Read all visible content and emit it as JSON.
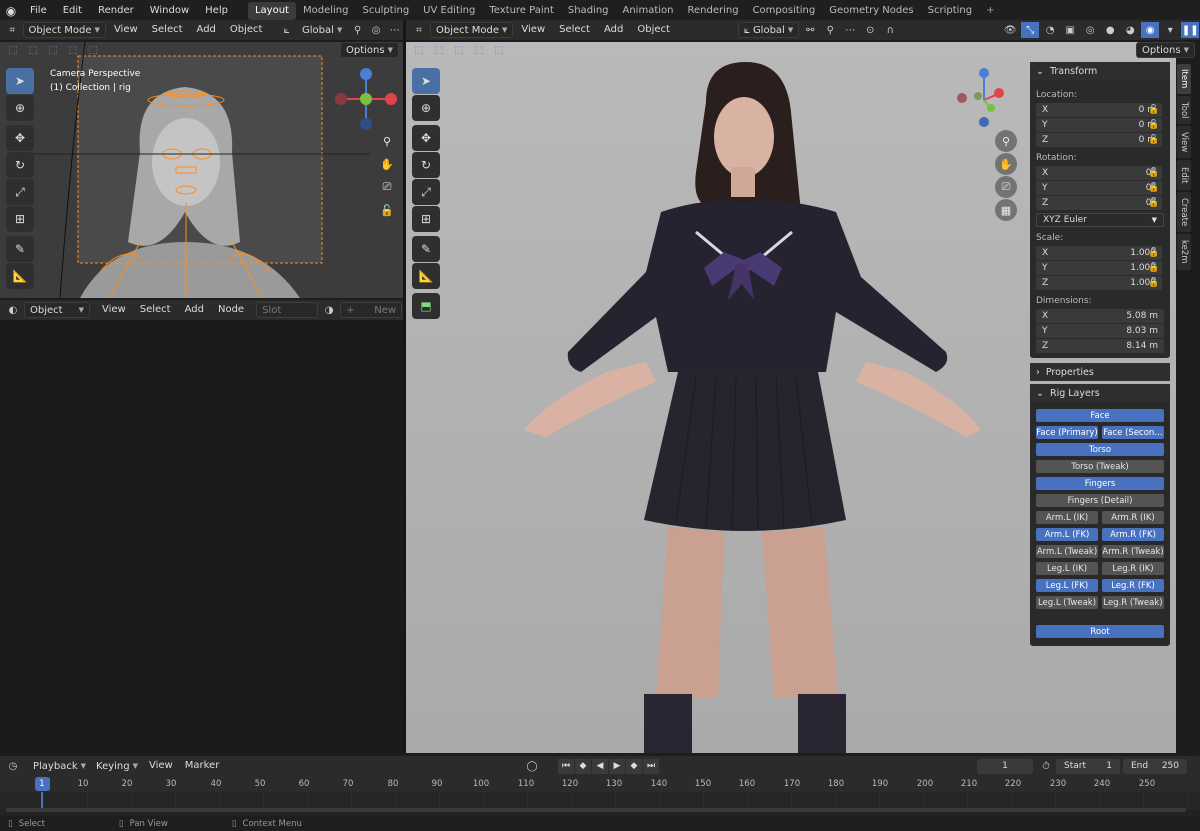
{
  "menu": {
    "items": [
      "File",
      "Edit",
      "Render",
      "Window",
      "Help"
    ]
  },
  "workspaces": {
    "items": [
      "Layout",
      "Modeling",
      "Sculpting",
      "UV Editing",
      "Texture Paint",
      "Shading",
      "Animation",
      "Rendering",
      "Compositing",
      "Geometry Nodes",
      "Scripting"
    ],
    "active": "Layout",
    "plus": "+"
  },
  "left_header": {
    "mode": "Object Mode",
    "menus": [
      "View",
      "Select",
      "Add",
      "Object"
    ],
    "orientation": "Global",
    "options": "Options"
  },
  "main_header": {
    "mode": "Object Mode",
    "menus": [
      "View",
      "Select",
      "Add",
      "Object"
    ],
    "orientation": "Global",
    "options": "Options"
  },
  "camera_overlay": {
    "line1": "Camera Perspective",
    "line2": "(1) Collection | rig"
  },
  "shader_header": {
    "type": "Object",
    "menus": [
      "View",
      "Select",
      "Add",
      "Node"
    ],
    "slot": "Slot",
    "new": "New"
  },
  "transform": {
    "title": "Transform",
    "location_label": "Location:",
    "location": [
      {
        "axis": "X",
        "value": "0 m"
      },
      {
        "axis": "Y",
        "value": "0 m"
      },
      {
        "axis": "Z",
        "value": "0 m"
      }
    ],
    "rotation_label": "Rotation:",
    "rotation": [
      {
        "axis": "X",
        "value": "0°"
      },
      {
        "axis": "Y",
        "value": "0°"
      },
      {
        "axis": "Z",
        "value": "0°"
      }
    ],
    "rotation_mode": "XYZ Euler",
    "scale_label": "Scale:",
    "scale": [
      {
        "axis": "X",
        "value": "1.000"
      },
      {
        "axis": "Y",
        "value": "1.000"
      },
      {
        "axis": "Z",
        "value": "1.000"
      }
    ],
    "dimensions_label": "Dimensions:",
    "dimensions": [
      {
        "axis": "X",
        "value": "5.08 m"
      },
      {
        "axis": "Y",
        "value": "8.03 m"
      },
      {
        "axis": "Z",
        "value": "8.14 m"
      }
    ]
  },
  "properties": {
    "title": "Properties"
  },
  "rig_layers": {
    "title": "Rig Layers",
    "face": "Face",
    "face_primary": "Face (Primary)",
    "face_secondary": "Face (Secon…",
    "torso": "Torso",
    "torso_tweak": "Torso (Tweak)",
    "fingers": "Fingers",
    "fingers_detail": "Fingers (Detail)",
    "arm_l_ik": "Arm.L (IK)",
    "arm_r_ik": "Arm.R (IK)",
    "arm_l_fk": "Arm.L (FK)",
    "arm_r_fk": "Arm.R (FK)",
    "arm_l_tweak": "Arm.L (Tweak)",
    "arm_r_tweak": "Arm.R (Tweak)",
    "leg_l_ik": "Leg.L (IK)",
    "leg_r_ik": "Leg.R (IK)",
    "leg_l_fk": "Leg.L (FK)",
    "leg_r_fk": "Leg.R (FK)",
    "leg_l_tweak": "Leg.L (Tweak)",
    "leg_r_tweak": "Leg.R (Tweak)",
    "root": "Root"
  },
  "sidebar_tabs": [
    "Item",
    "Tool",
    "View",
    "Edit",
    "Create",
    "ke2m"
  ],
  "timeline": {
    "menus": [
      "Playback",
      "Keying",
      "View",
      "Marker"
    ],
    "current_frame": "1",
    "start_label": "Start",
    "start": "1",
    "end_label": "End",
    "end": "250",
    "ticks": [
      "1",
      "10",
      "20",
      "30",
      "40",
      "50",
      "60",
      "70",
      "80",
      "90",
      "100",
      "110",
      "120",
      "130",
      "140",
      "150",
      "160",
      "170",
      "180",
      "190",
      "200",
      "210",
      "220",
      "230",
      "240",
      "250"
    ]
  },
  "statusbar": {
    "select": "Select",
    "pan": "Pan View",
    "context": "Context Menu"
  },
  "colors": {
    "accent": "#4872c0",
    "viewport_bg": "#b3b3b3",
    "selection_orange": "#ff8c1a"
  }
}
